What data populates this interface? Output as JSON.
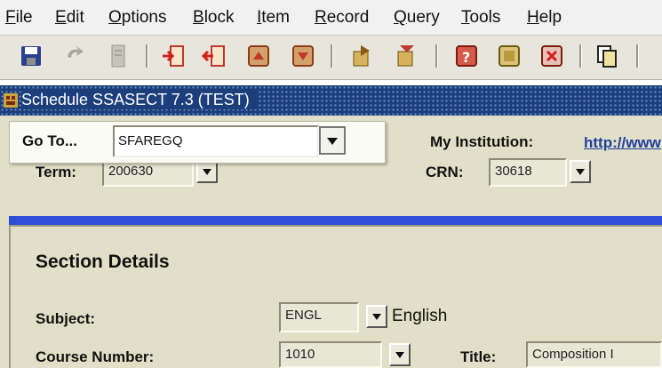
{
  "menu": [
    "File",
    "Edit",
    "Options",
    "Block",
    "Item",
    "Record",
    "Query",
    "Tools",
    "Help"
  ],
  "toolbar": {
    "buttons": [
      "save-icon",
      "rollback-icon",
      "print-icon",
      "insert-record-icon",
      "remove-record-icon",
      "previous-block-icon",
      "next-block-icon",
      "enter-query-icon",
      "execute-query-icon",
      "help-icon",
      "exit-icon",
      "cancel-icon",
      "copy-icon"
    ]
  },
  "window": {
    "title": "Schedule SSASECT 7.3 (TEST)"
  },
  "goto": {
    "label": "Go To...",
    "value": "SFAREGQ"
  },
  "key_block": {
    "term_label": "Term:",
    "term_value": "200630",
    "crn_label": "CRN:",
    "crn_value": "30618",
    "institution_label": "My Institution:",
    "institution_link": "http://www"
  },
  "section": {
    "heading": "Section Details",
    "subject_label": "Subject:",
    "subject_value": "ENGL",
    "subject_desc": "English",
    "course_label": "Course Number:",
    "course_value": "1010",
    "title_label": "Title:",
    "title_value": "Composition I"
  },
  "colors": {
    "title_bar": "#1c3f7c",
    "form_bg": "#e1dfc7",
    "blue_bar": "#2f4dd6",
    "link": "#1f3fa0"
  }
}
